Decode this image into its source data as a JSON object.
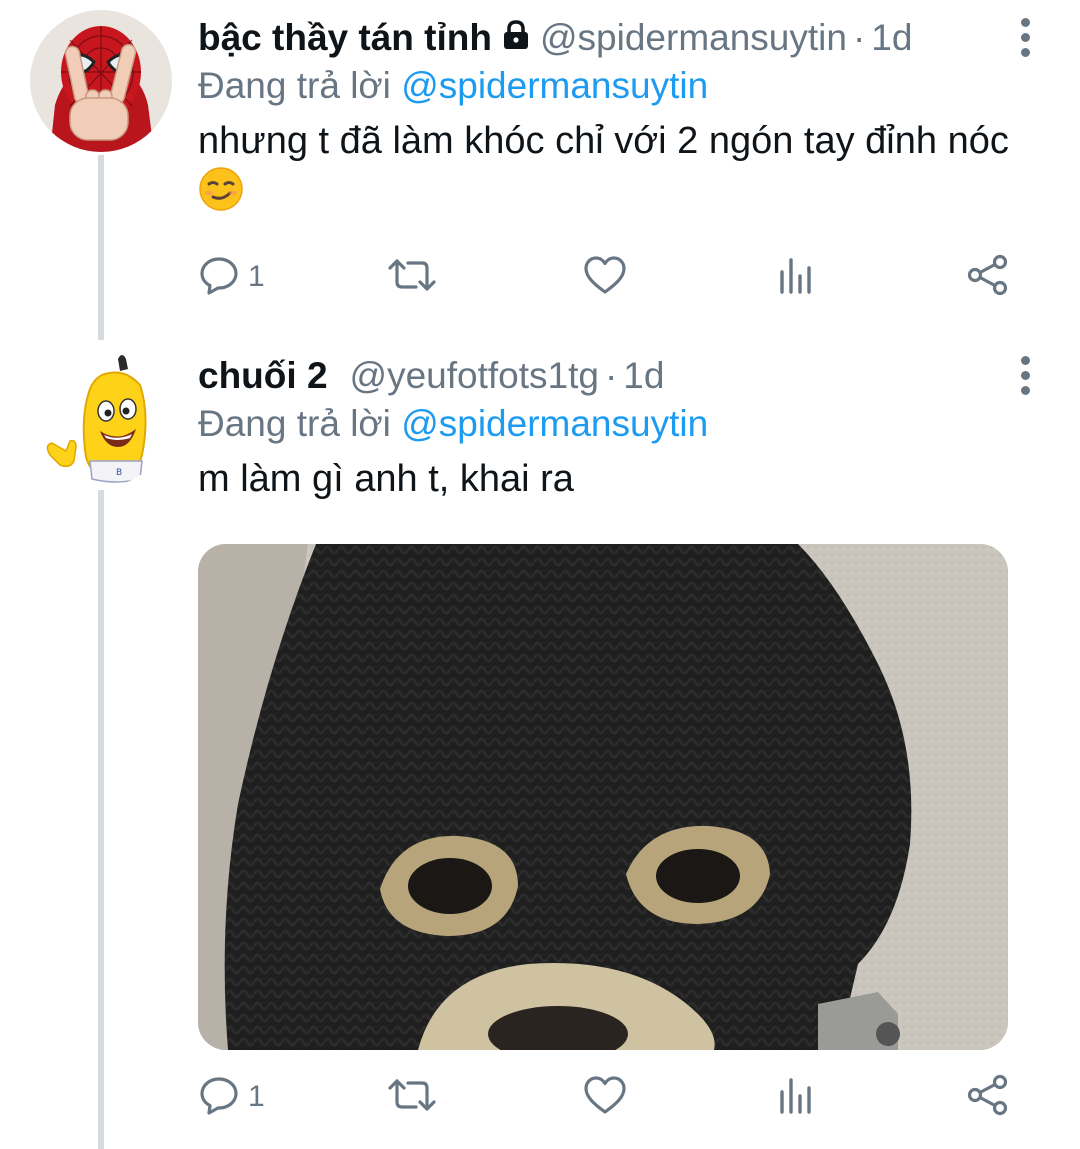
{
  "tweets": [
    {
      "display_name": "bậc thầy tán tỉnh",
      "handle": "@spidermansuytin",
      "separator": "·",
      "time": "1d",
      "reply_prefix": "Đang trả lời",
      "reply_to": "@spidermansuytin",
      "text": "nhưng t đã làm khóc chỉ với 2 ngón tay đỉnh nóc",
      "reply_count": "1",
      "protected_icon": "lock-icon",
      "emoji": "smirking-face-emoji"
    },
    {
      "display_name": "chuối 2",
      "handle": "@yeufotfots1tg",
      "separator": "·",
      "time": "1d",
      "reply_prefix": "Đang trả lời",
      "reply_to": "@spidermansuytin",
      "text": "m làm gì anh t, khai ra",
      "reply_count": "1",
      "media": "balaclava-dog-image"
    }
  ],
  "colors": {
    "text": "#0f1419",
    "secondary": "#687684",
    "link": "#1d9bf0",
    "thread_line": "#d6dbdf"
  },
  "icons": [
    "reply-icon",
    "retweet-icon",
    "like-icon",
    "analytics-icon",
    "share-icon",
    "more-icon"
  ]
}
